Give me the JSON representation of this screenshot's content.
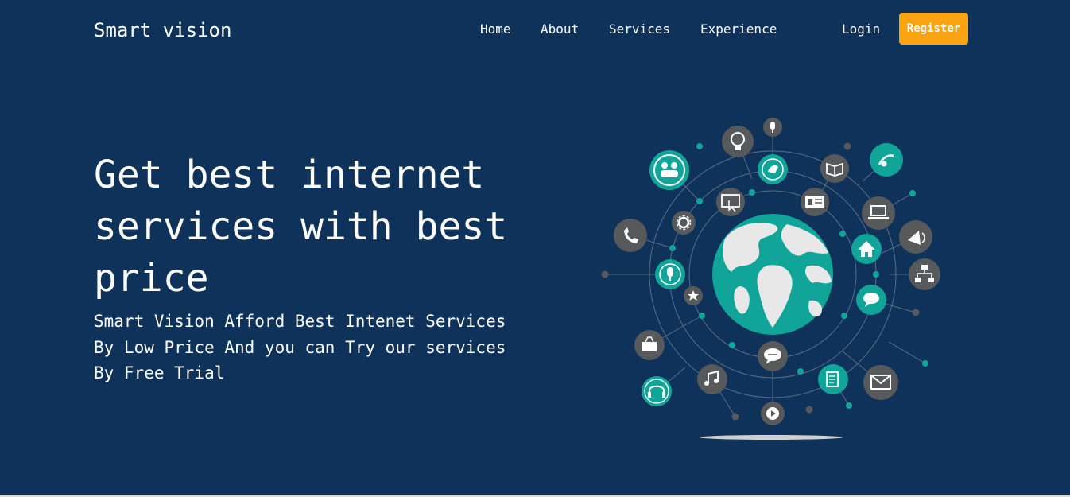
{
  "brand": {
    "name": "Smart vision"
  },
  "nav": {
    "items": [
      {
        "label": "Home"
      },
      {
        "label": "About"
      },
      {
        "label": "Services"
      },
      {
        "label": "Experience"
      }
    ],
    "login_label": "Login",
    "register_label": "Register"
  },
  "hero": {
    "title": "Get best internet services with best price",
    "subtitle": "Smart Vision Afford Best Intenet Services By Low Price And you can Try our services By Free Trial"
  },
  "illustration": {
    "icons": [
      "people-icon",
      "lightbulb-icon",
      "microphone-icon",
      "bird-icon",
      "book-icon",
      "music-note-icon",
      "monitor-touch-icon",
      "id-card-icon",
      "laptop-icon",
      "gear-icon",
      "phone-icon",
      "megaphone-icon",
      "home-icon",
      "sitemap-icon",
      "microphone-icon",
      "star-icon",
      "chat-icon",
      "shopping-bag-icon",
      "speech-bubble-icon",
      "music-icon",
      "notepad-icon",
      "mail-icon",
      "headphones-icon",
      "play-icon",
      "globe-icon"
    ]
  },
  "colors": {
    "background": "#0e325a",
    "accent": "#fca311",
    "teal": "#11a59a",
    "gray": "#58595b",
    "text": "#ffffff"
  }
}
